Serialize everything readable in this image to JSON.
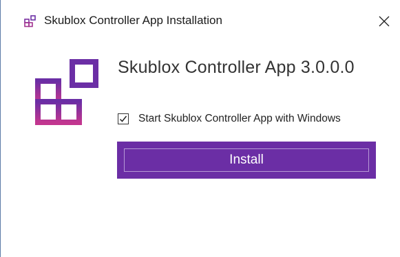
{
  "window": {
    "title": "Skublox Controller App Installation",
    "icon": "skublox-logo-icon",
    "close_icon": "close-icon"
  },
  "main": {
    "app_name": "Skublox Controller App 3.0.0.0",
    "start_with_windows": {
      "label": "Start Skublox Controller App with Windows",
      "checked": true
    },
    "install_button": {
      "label": "Install"
    }
  },
  "colors": {
    "accent": "#6b2ea5",
    "logo_gradient_top": "#6b2ea5",
    "logo_gradient_bottom": "#c2368f"
  }
}
